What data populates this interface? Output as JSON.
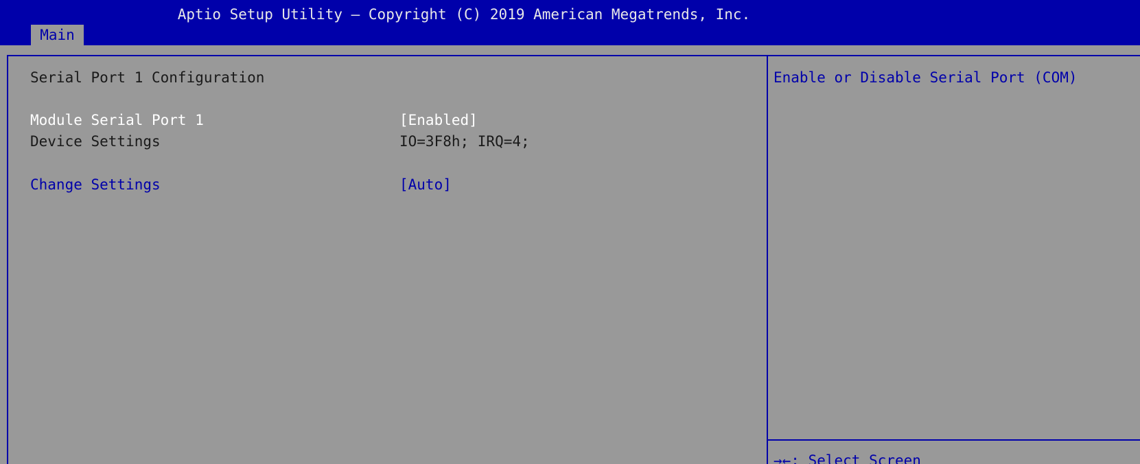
{
  "header": {
    "title": "Aptio Setup Utility – Copyright (C) 2019 American Megatrends, Inc.",
    "tabs": [
      {
        "label": "Main",
        "active": true
      }
    ]
  },
  "main": {
    "section_title": "Serial Port 1 Configuration",
    "items": [
      {
        "label": "Module Serial Port 1",
        "value": "[Enabled]",
        "selectable": false
      },
      {
        "label": "Device Settings",
        "value": "IO=3F8h; IRQ=4;",
        "selectable": false
      },
      {
        "label": "Change Settings",
        "value": "[Auto]",
        "selectable": true
      }
    ]
  },
  "help": {
    "description": "Enable or Disable Serial Port (COM)",
    "key_hints": [
      {
        "keys": "→←",
        "action": "Select Screen"
      }
    ]
  },
  "colors": {
    "background": "#999999",
    "header_blue": "#0000aa",
    "highlight_text": "#ffffff",
    "normal_text": "#1a1a1a",
    "selectable_text": "#0000aa"
  }
}
